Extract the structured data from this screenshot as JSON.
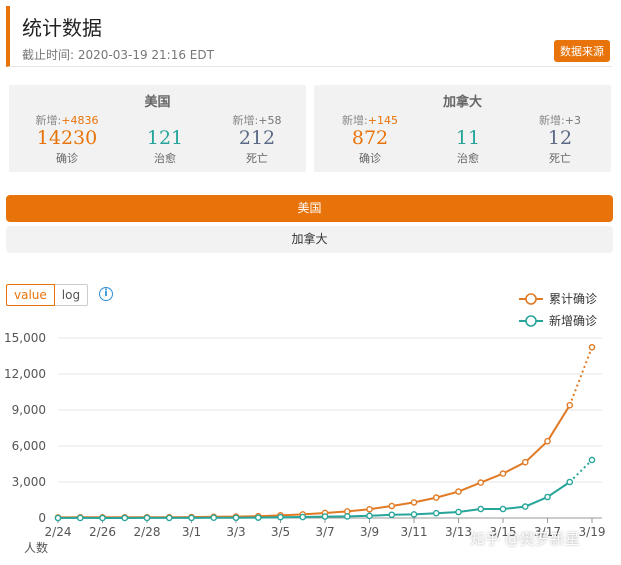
{
  "header": {
    "title": "统计数据",
    "updated": "截止时间: 2020-03-19 21:16 EDT",
    "source_button": "数据来源"
  },
  "cards": [
    {
      "country": "美国",
      "confirmed": {
        "delta_label": "新增:",
        "delta": "+4836",
        "value": "14230",
        "label": "确诊"
      },
      "cured": {
        "value": "121",
        "label": "治愈"
      },
      "deaths": {
        "delta_label": "新增:",
        "delta": "+58",
        "value": "212",
        "label": "死亡"
      }
    },
    {
      "country": "加拿大",
      "confirmed": {
        "delta_label": "新增:",
        "delta": "+145",
        "value": "872",
        "label": "确诊"
      },
      "cured": {
        "value": "11",
        "label": "治愈"
      },
      "deaths": {
        "delta_label": "新增:",
        "delta": "+3",
        "value": "12",
        "label": "死亡"
      }
    }
  ],
  "tabs": [
    "美国",
    "加拿大"
  ],
  "scale_toggle": {
    "value": "value",
    "log": "log"
  },
  "info_icon": "info-icon",
  "watermark": "知乎 @樊罗新星",
  "colors": {
    "accent": "#e8730a",
    "cumulative": "#e07a25",
    "new": "#27a59a",
    "deaths": "#5c6a86"
  },
  "chart_data": {
    "type": "line",
    "x": [
      "2/24",
      "2/25",
      "2/26",
      "2/27",
      "2/28",
      "2/29",
      "3/1",
      "3/2",
      "3/3",
      "3/4",
      "3/5",
      "3/6",
      "3/7",
      "3/8",
      "3/9",
      "3/10",
      "3/11",
      "3/12",
      "3/13",
      "3/14",
      "3/15",
      "3/16",
      "3/17",
      "3/18",
      "3/19"
    ],
    "x_tick_labels": [
      "2/24",
      "2/26",
      "2/28",
      "3/1",
      "3/3",
      "3/5",
      "3/7",
      "3/9",
      "3/11",
      "3/13",
      "3/15",
      "3/17",
      "3/19"
    ],
    "ylim": [
      0,
      15000
    ],
    "y_ticks": [
      "0",
      "3,000",
      "6,000",
      "9,000",
      "12,000",
      "15,000"
    ],
    "ylabel": "人数",
    "legend_position": "top-right",
    "grid": true,
    "series": [
      {
        "name": "累计确诊",
        "color": "#e07a25",
        "values": [
          50,
          55,
          58,
          60,
          62,
          68,
          75,
          100,
          120,
          150,
          220,
          300,
          420,
          550,
          730,
          1000,
          1300,
          1700,
          2200,
          2950,
          3700,
          4650,
          6400,
          9400,
          14230
        ],
        "dotted_last": true
      },
      {
        "name": "新增确诊",
        "color": "#27a59a",
        "values": [
          0,
          5,
          3,
          2,
          5,
          6,
          10,
          25,
          20,
          30,
          70,
          80,
          120,
          130,
          180,
          270,
          300,
          400,
          500,
          750,
          750,
          950,
          1750,
          3000,
          4836
        ],
        "dotted_last": true
      }
    ]
  }
}
